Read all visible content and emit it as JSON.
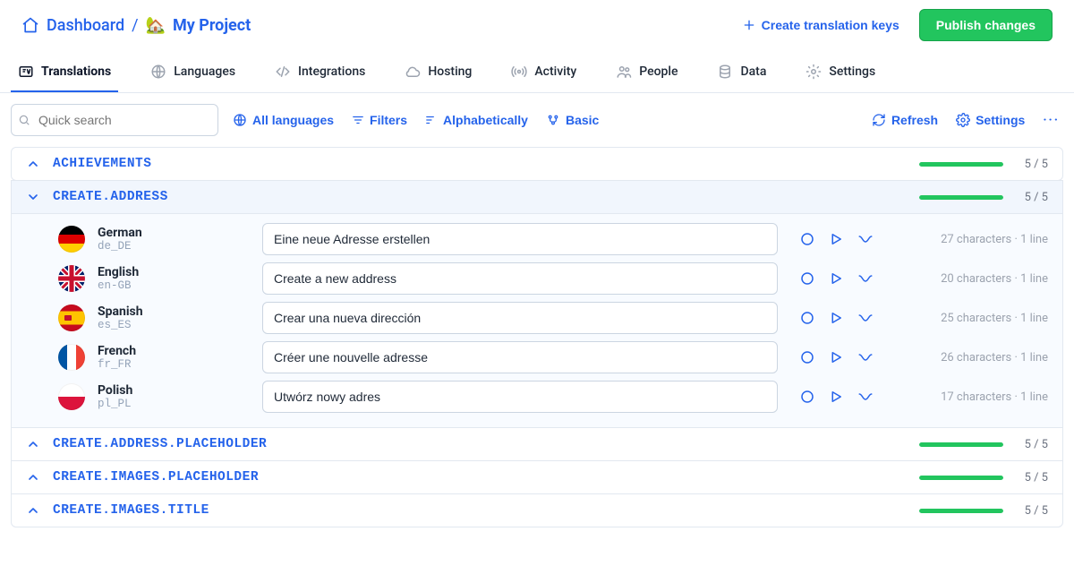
{
  "header": {
    "dashboard": "Dashboard",
    "project_emoji": "🏡",
    "project_name": "My Project",
    "create_keys_label": "Create translation keys",
    "publish_label": "Publish changes"
  },
  "tabs": [
    {
      "id": "translations",
      "label": "Translations",
      "active": true,
      "icon": "translations"
    },
    {
      "id": "languages",
      "label": "Languages",
      "icon": "globe"
    },
    {
      "id": "integrations",
      "label": "Integrations",
      "icon": "code"
    },
    {
      "id": "hosting",
      "label": "Hosting",
      "icon": "cloud"
    },
    {
      "id": "activity",
      "label": "Activity",
      "icon": "broadcast"
    },
    {
      "id": "people",
      "label": "People",
      "icon": "people"
    },
    {
      "id": "data",
      "label": "Data",
      "icon": "database"
    },
    {
      "id": "settings",
      "label": "Settings",
      "icon": "gear"
    }
  ],
  "toolbar": {
    "search_placeholder": "Quick search",
    "all_languages": "All languages",
    "filters": "Filters",
    "sort": "Alphabetically",
    "view": "Basic",
    "refresh": "Refresh",
    "settings": "Settings"
  },
  "keys": [
    {
      "name": "ACHIEVEMENTS",
      "expanded": false,
      "done": 5,
      "total": 5
    },
    {
      "name": "CREATE.ADDRESS",
      "expanded": true,
      "done": 5,
      "total": 5,
      "rows": [
        {
          "lang": "German",
          "code": "de_DE",
          "flag": "de",
          "value": "Eine neue Adresse erstellen",
          "chars": 27,
          "lines": 1
        },
        {
          "lang": "English",
          "code": "en-GB",
          "flag": "gb",
          "value": "Create a new address",
          "chars": 20,
          "lines": 1
        },
        {
          "lang": "Spanish",
          "code": "es_ES",
          "flag": "es",
          "value": "Crear una nueva dirección",
          "chars": 25,
          "lines": 1
        },
        {
          "lang": "French",
          "code": "fr_FR",
          "flag": "fr",
          "value": "Créer une nouvelle adresse",
          "chars": 26,
          "lines": 1
        },
        {
          "lang": "Polish",
          "code": "pl_PL",
          "flag": "pl",
          "value": "Utwórz nowy adres",
          "chars": 17,
          "lines": 1
        }
      ]
    },
    {
      "name": "CREATE.ADDRESS.PLACEHOLDER",
      "expanded": false,
      "done": 5,
      "total": 5
    },
    {
      "name": "CREATE.IMAGES.PLACEHOLDER",
      "expanded": false,
      "done": 5,
      "total": 5
    },
    {
      "name": "CREATE.IMAGES.TITLE",
      "expanded": false,
      "done": 5,
      "total": 5
    }
  ],
  "meta_template": {
    "chars_word": "characters",
    "line_word_singular": "line"
  }
}
